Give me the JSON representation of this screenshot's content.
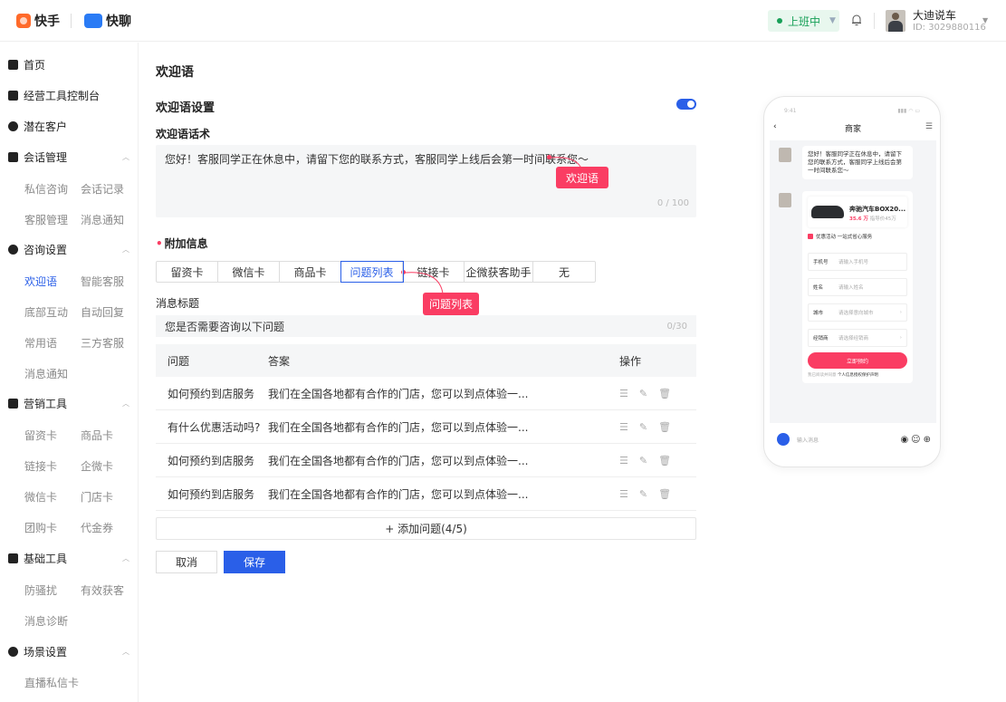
{
  "header": {
    "brand1": "快手",
    "brand2": "快聊",
    "status_label": "上班中",
    "user_name": "大迪说车",
    "user_id": "ID: 3029880116"
  },
  "sidebar": {
    "groups": [
      {
        "label": "首页"
      },
      {
        "label": "经营工具控制台"
      },
      {
        "label": "潜在客户"
      },
      {
        "label": "会话管理"
      },
      {
        "label": "咨询设置"
      },
      {
        "label": "营销工具"
      },
      {
        "label": "基础工具"
      },
      {
        "label": "场景设置"
      }
    ],
    "subs": {
      "s1": "私信咨询",
      "s2": "会话记录",
      "s3": "客服管理",
      "s4": "消息通知",
      "s5": "欢迎语",
      "s6": "智能客服",
      "s7": "底部互动",
      "s8": "自动回复",
      "s9": "常用语",
      "s10": "三方客服",
      "s11": "消息通知",
      "s12": "留资卡",
      "s13": "商品卡",
      "s14": "链接卡",
      "s15": "企微卡",
      "s16": "微信卡",
      "s17": "门店卡",
      "s18": "团购卡",
      "s19": "代金券",
      "s20": "防骚扰",
      "s21": "有效获客",
      "s22": "消息诊断",
      "s23": "直播私信卡"
    }
  },
  "main": {
    "page_title": "欢迎语",
    "section_title": "欢迎语设置",
    "script_label": "欢迎语话术",
    "welcome_text": "您好！客服同学正在休息中，请留下您的联系方式，客服同学上线后会第一时间联系您～",
    "welcome_count": "0 / 100",
    "tip_welcome": "欢迎语",
    "extra_label": "附加信息",
    "tabs": [
      "留资卡",
      "微信卡",
      "商品卡",
      "问题列表",
      "链接卡",
      "企微获客助手",
      "无"
    ],
    "tip_questions": "问题列表",
    "msg_title_label": "消息标题",
    "msg_title_value": "您是否需要咨询以下问题",
    "msg_title_count": "0/30",
    "table": {
      "headers": [
        "问题",
        "答案",
        "操作"
      ],
      "rows": [
        {
          "q": "如何预约到店服务",
          "a": "我们在全国各地都有合作的门店，您可以到点体验一..."
        },
        {
          "q": "有什么优惠活动吗?",
          "a": "我们在全国各地都有合作的门店，您可以到点体验一..."
        },
        {
          "q": "如何预约到店服务",
          "a": "我们在全国各地都有合作的门店，您可以到点体验一..."
        },
        {
          "q": "如何预约到店服务",
          "a": "我们在全国各地都有合作的门店，您可以到点体验一..."
        }
      ]
    },
    "add_question": "+ 添加问题(4/5)",
    "cancel": "取消",
    "save": "保存"
  },
  "phone": {
    "time": "9:41",
    "title": "商家",
    "greeting": "您好！客服同学正在休息中，请留下您的联系方式，客服同学上线后会第一时间联系您～",
    "car_name": "奔驰汽车BOX20...",
    "car_price": "35.6 万",
    "car_price_note": "指导价45万",
    "promo": "优惠活动 一站式省心服务",
    "fields": [
      {
        "label": "手机号",
        "placeholder": "请输入手机号"
      },
      {
        "label": "姓名",
        "placeholder": "请输入姓名"
      },
      {
        "label": "城市",
        "placeholder": "请选择意向城市"
      },
      {
        "label": "经销商",
        "placeholder": "请选择经销商"
      }
    ],
    "submit": "立即预约",
    "agree": "我已阅读并同意",
    "agree_link": "个人信息授权保护声明",
    "input_placeholder": "输入消息"
  },
  "colors": {
    "accent": "#2a5fe8",
    "tip": "#fa3d63",
    "online": "#18a058"
  }
}
